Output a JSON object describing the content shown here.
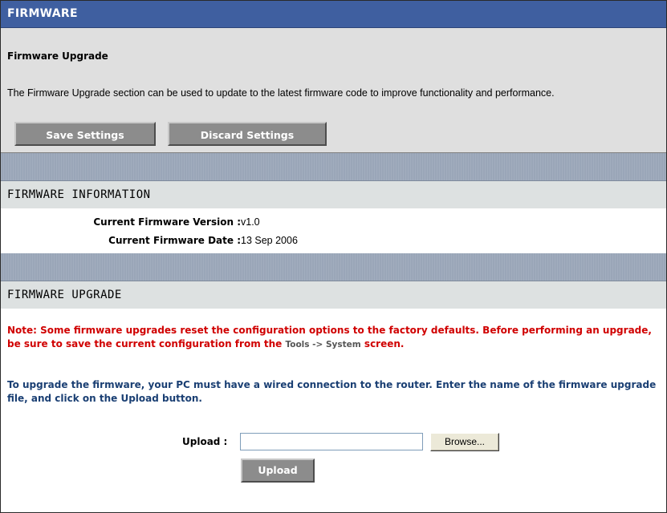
{
  "header": {
    "title": "FIRMWARE"
  },
  "intro": {
    "title": "Firmware Upgrade",
    "description": "The Firmware Upgrade section can be used to update to the latest firmware code to improve functionality and performance.",
    "save_label": "Save Settings",
    "discard_label": "Discard Settings"
  },
  "firmware_info": {
    "heading": "FIRMWARE INFORMATION",
    "version_label": "Current Firmware Version :",
    "version_value": "v1.0",
    "date_label": "Current Firmware Date :",
    "date_value": "13 Sep 2006"
  },
  "firmware_upgrade": {
    "heading": "FIRMWARE UPGRADE",
    "note_prefix": "Note: Some firmware upgrades reset the configuration options to the factory defaults. Before performing an upgrade, be sure to save the current configuration from the",
    "note_tools": "Tools -> System",
    "note_suffix": "screen.",
    "instructions": "To upgrade the firmware, your PC must have a wired connection to the router. Enter the name of the firmware upgrade file, and click on the Upload button.",
    "upload_label": "Upload :",
    "upload_value": "",
    "browse_label": "Browse...",
    "upload_button": "Upload"
  },
  "colors": {
    "header_bg": "#3f5fa0",
    "note_text": "#d00000",
    "instruction_text": "#1a3f73",
    "button_bg": "#8c8c8c"
  }
}
